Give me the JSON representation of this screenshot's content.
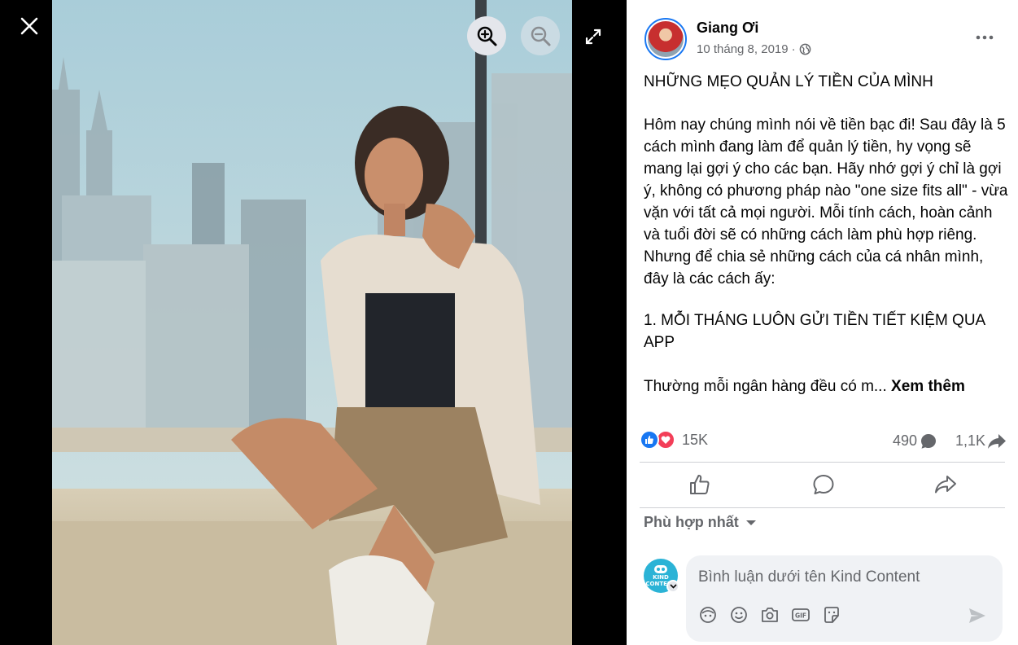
{
  "viewer": {
    "photo_alt": "",
    "icons": {
      "close": "close-icon",
      "zoom_in": "zoom-in-icon",
      "zoom_out": "zoom-out-icon",
      "fullscreen": "fullscreen-icon"
    }
  },
  "post": {
    "author": "Giang Ơi",
    "date": "10 tháng 8, 2019",
    "audience_icon": "globe-icon",
    "title": "NHỮNG MẸO QUẢN LÝ TIỀN CỦA MÌNH",
    "body": "Hôm nay chúng mình nói về tiền bạc đi! Sau đây là 5 cách mình đang làm để quản lý tiền, hy vọng sẽ mang lại gợi ý cho các bạn. Hãy nhớ gợi ý chỉ là gợi ý, không có phương pháp nào \"one size fits all\" - vừa vặn với tất cả mọi người. Mỗi tính cách, hoàn cảnh và tuổi đời sẽ có những cách làm phù hợp riêng. Nhưng để chia sẻ những cách của cá nhân mình, đây là các cách ấy:",
    "item1": "1. MỖI THÁNG LUÔN GỬI TIỀN TIẾT KIỆM QUA APP",
    "truncated": "Thường mỗi ngân hàng đều có m...",
    "see_more": "Xem thêm"
  },
  "stats": {
    "reactions": "15K",
    "comments": "490",
    "shares": "1,1K"
  },
  "comments": {
    "sort_label": "Phù hợp nhất",
    "input_placeholder": "Bình luận dưới tên Kind Content",
    "avatar_brand_top": "KIND",
    "avatar_brand_bottom": "CONTENT"
  },
  "colors": {
    "brand_blue": "#1877f2",
    "love_red": "#f33e58",
    "secondary_text": "#65676b",
    "input_bg": "#f0f2f5"
  }
}
